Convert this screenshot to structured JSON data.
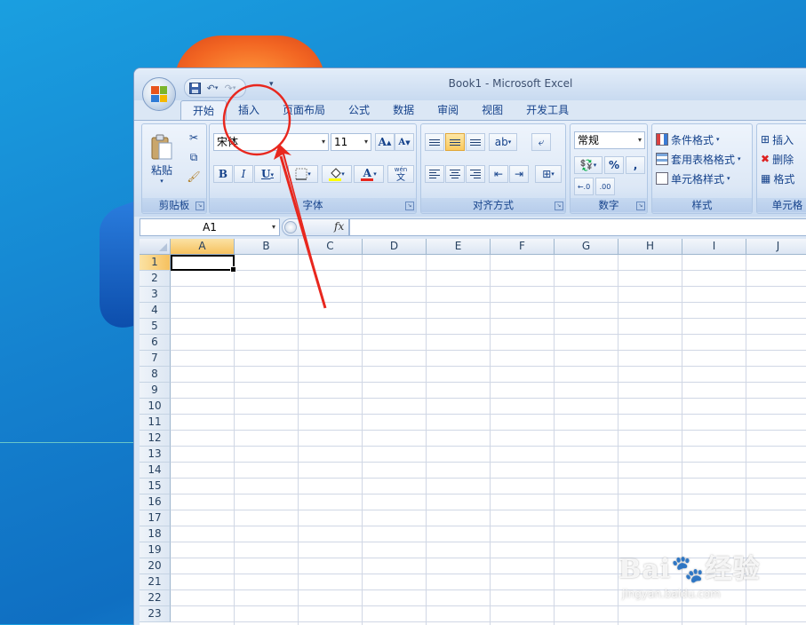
{
  "window": {
    "title": "Book1 - Microsoft Excel"
  },
  "tabs": [
    "开始",
    "插入",
    "页面布局",
    "公式",
    "数据",
    "审阅",
    "视图",
    "开发工具"
  ],
  "ribbon": {
    "clipboard": {
      "paste_label": "粘贴",
      "group_label": "剪贴板"
    },
    "font": {
      "font_name": "宋体",
      "font_size": "11",
      "group_label": "字体",
      "bold": "B",
      "italic": "I",
      "underline": "U",
      "grow": "A",
      "shrink": "A",
      "font_color": "A",
      "phonetic_top": "wén",
      "phonetic_bottom": "文"
    },
    "alignment": {
      "group_label": "对齐方式"
    },
    "number": {
      "format": "常规",
      "percent": "%",
      "comma": ",",
      "group_label": "数字"
    },
    "styles": {
      "conditional": "条件格式",
      "table": "套用表格格式",
      "cell_styles": "单元格样式",
      "group_label": "样式"
    },
    "cells": {
      "insert": "插入",
      "delete": "删除",
      "format": "格式",
      "group_label": "单元格"
    }
  },
  "formula_bar": {
    "name_box": "A1",
    "fx": "fx",
    "formula": ""
  },
  "sheet": {
    "columns": [
      "A",
      "B",
      "C",
      "D",
      "E",
      "F",
      "G",
      "H",
      "I",
      "J"
    ],
    "rows": [
      "1",
      "2",
      "3",
      "4",
      "5",
      "6",
      "7",
      "8",
      "9",
      "10",
      "11",
      "12",
      "13",
      "14",
      "15",
      "16",
      "17",
      "18",
      "19",
      "20",
      "21",
      "22",
      "23"
    ],
    "active_cell": "A1"
  },
  "watermark": {
    "brand": "Bai",
    "brand2": "经验",
    "url": "jingyan.baidu.com"
  },
  "colors": {
    "annotation": "#e8271e",
    "tab_text": "#15428b",
    "selected_header": "#f6c15f"
  }
}
